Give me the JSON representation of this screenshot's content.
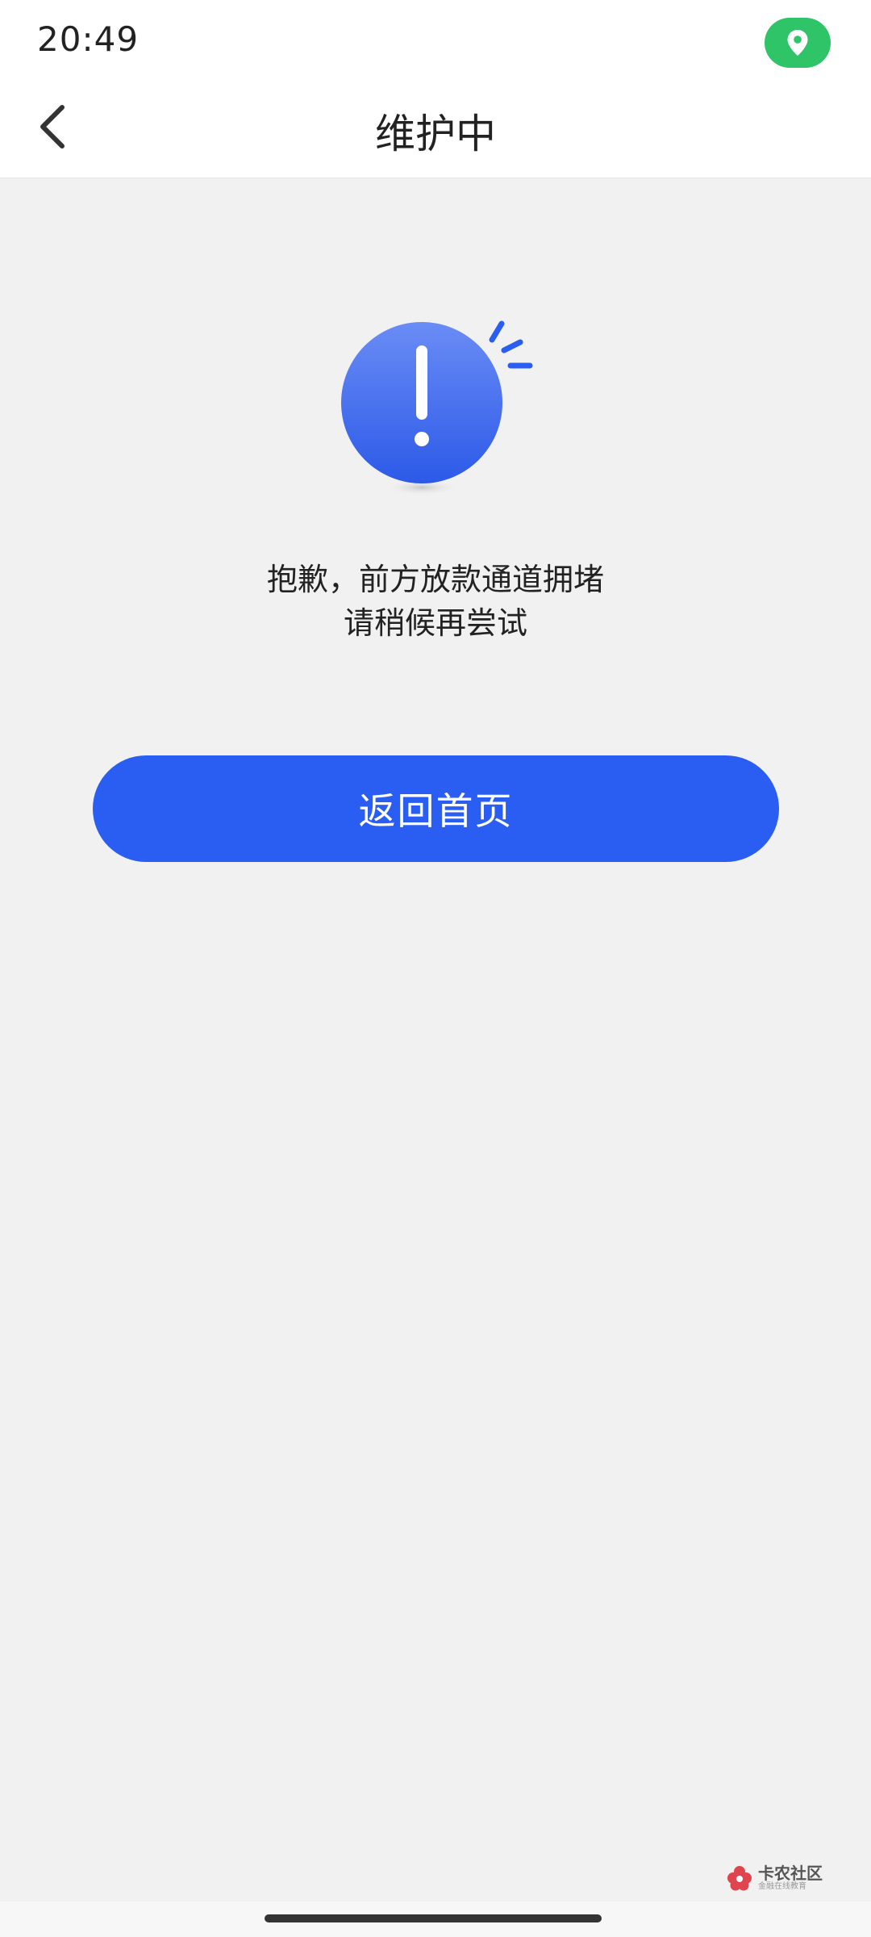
{
  "status_bar": {
    "time": "20:49",
    "location_icon": "location-pin-icon",
    "location_color": "#2fc467"
  },
  "nav": {
    "back_icon": "chevron-left-icon",
    "title": "维护中"
  },
  "content": {
    "illustration_icon": "exclamation-alert-icon",
    "message_line1": "抱歉，前方放款通道拥堵",
    "message_line2": "请稍候再尝试",
    "home_button_label": "返回首页"
  },
  "watermark": {
    "title": "卡农社区",
    "subtitle": "金融在线教育"
  },
  "colors": {
    "accent": "#2a5ef2",
    "background": "#f1f1f1",
    "header": "#ffffff"
  }
}
